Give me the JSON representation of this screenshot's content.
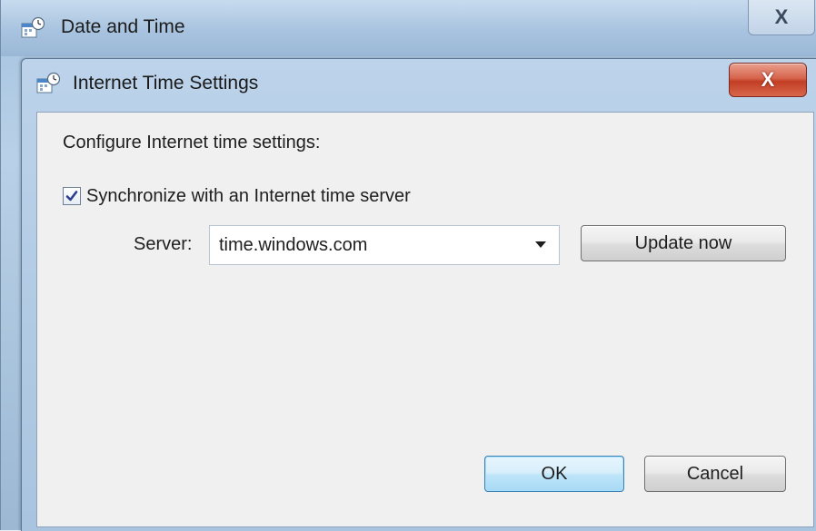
{
  "outer_window": {
    "title": "Date and Time",
    "close_glyph": "X"
  },
  "dialog": {
    "title": "Internet Time Settings",
    "close_glyph": "X",
    "heading": "Configure Internet time settings:",
    "sync": {
      "label": "Synchronize with an Internet time server",
      "checked": true
    },
    "server": {
      "label": "Server:",
      "value": "time.windows.com"
    },
    "update_button": "Update now",
    "ok_button": "OK",
    "cancel_button": "Cancel"
  },
  "colors": {
    "close_button_red": "#c23e24",
    "default_button_blue": "#3c7fb1",
    "checkmark": "#2a3f8f"
  },
  "icons": [
    "date-time-icon",
    "close-icon",
    "checkmark-icon",
    "dropdown-arrow-icon"
  ]
}
